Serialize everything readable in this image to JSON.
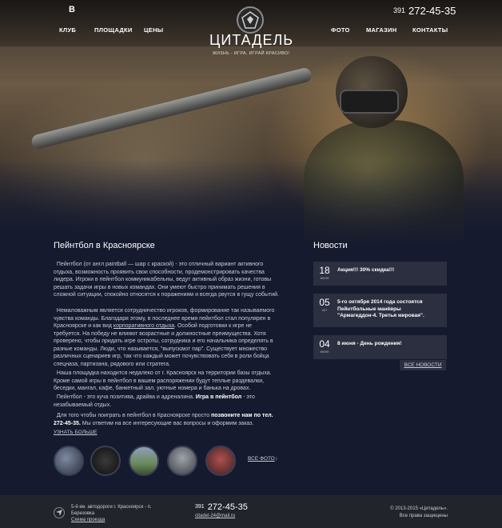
{
  "header": {
    "vk_label": "В",
    "phone_code": "391",
    "phone_number": "272-45-35",
    "nav_left": [
      "КЛУБ",
      "ПЛОЩАДКИ",
      "ЦЕНЫ"
    ],
    "nav_right": [
      "ФОТО",
      "МАГАЗИН",
      "КОНТАКТЫ"
    ],
    "logo_title": "ЦИТАДЕЛЬ",
    "logo_tagline": "ЖИЗНЬ - ИГРА, ИГРАЙ КРАСИВО!"
  },
  "main": {
    "title": "Пейнтбол в Красноярске",
    "p1": "Пейнтбол (от англ paintball — шар с краской) - это отличный вариант активного отдыха, возможность проявить свои способности, продемонстрировать качества лидера. Игроки в пейнтбол коммуникабельны, ведут активный образ жизни, готовы решать задачи игры в новых командах. Они умеют быстро принимать решения в сложной ситуации, спокойно относятся к поражениям и всегда рвутся в гущу событий.",
    "p2_before": "Немаловажным является сотрудничество игроков, формирование так называемого чувства команды. Благодаря этому, в последнее время пейнтбол стал популярен в Красноярске и как вид ",
    "p2_link": "корпоративного отдыха",
    "p2_after": ". Особой подготовки к игре не требуется. На победу не влияют возрастные и должностные преимущества. Хотя проверено, чтобы придать игре остроты, сотрудника и его начальника определять в разные команды. Люди, что называется, \"выпускают пар\". Существует множество различных сценариев игр, так что каждый может почувствовать себя в роли бойца спецназа, партизана, рядового или стратега.",
    "p3": "Наша площадка находится недалеко от г. Красноярск на территории базы отдыха. Кроме самой игры в пейнтбол в вашем распоряжении будут теплые раздевалки, беседки, мангал, кафе, банкетный зал, уютные номера и банька на дровах.",
    "p4_before": "Пейнтбол - это куча позитива, драйва и адреналина. ",
    "p4_bold": "Игра в пейнтбол",
    "p4_after": " - это незабываемый отдых.",
    "p5_before": "Для того чтобы поиграть в пейнтбол в Красноярске просто ",
    "p5_bold": "позвоните нам по тел. 272-45-35.",
    "p5_after": " Мы ответим на все интересующие вас вопросы и оформим заказ.",
    "more_label": "УЗНАТЬ БОЛЬШЕ",
    "all_photo_label": "ВСЕ ФОТО"
  },
  "news": {
    "title": "Новости",
    "items": [
      {
        "day": "18",
        "month": "июня",
        "text": "Акция!!! 30% скидка!!!"
      },
      {
        "day": "05",
        "month": "окт",
        "text": "5-го октября 2014 года состоятся Пейнтбольные манёвры \"Армагеддон-4. Третья мировая\"."
      },
      {
        "day": "04",
        "month": "июня",
        "text": "8 июня - День рождения!"
      }
    ],
    "all_label": "ВСЕ НОВОСТИ"
  },
  "footer": {
    "address": "5-й км. автодороги г. Красноярск - п. Березовка",
    "map_link": "Схема проезда",
    "phone_code": "391",
    "phone_number": "272-45-35",
    "email": "citadel-24@mail.ru",
    "copyright": "© 2013-2015 «Цитадель».",
    "rights": "Все права защищены"
  },
  "colors": {
    "background": "#151a2e",
    "news_box": "#2b2f40",
    "footer": "#22242c"
  }
}
